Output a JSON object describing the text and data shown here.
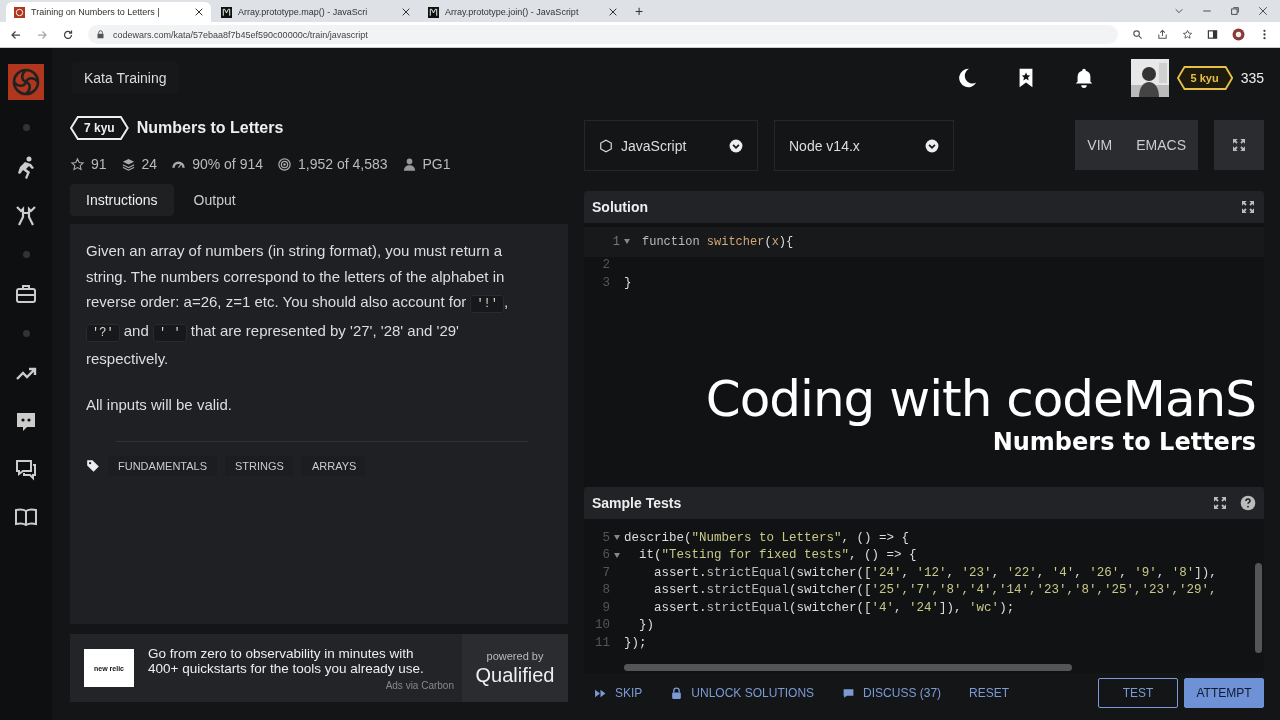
{
  "browser": {
    "tabs": [
      {
        "title": "Training on Numbers to Letters |",
        "selected": true
      },
      {
        "title": "Array.prototype.map() - JavaScri",
        "selected": false
      },
      {
        "title": "Array.prototype.join() - JavaScript",
        "selected": false
      }
    ],
    "new_tab": "+",
    "url": "codewars.com/kata/57ebaa8f7b45ef590c00000c/train/javascript"
  },
  "header": {
    "title": "Kata Training",
    "rank": "5 kyu",
    "honor": "335"
  },
  "kata": {
    "rank": "7 kyu",
    "title": "Numbers to Letters",
    "stats": [
      {
        "kind": "star",
        "text": "91"
      },
      {
        "kind": "collection",
        "text": "24"
      },
      {
        "kind": "satisfaction",
        "text": "90% of 914"
      },
      {
        "kind": "completed",
        "text": "1,952 of 4,583"
      },
      {
        "kind": "author",
        "text": "PG1"
      }
    ],
    "tabs": [
      {
        "label": "Instructions",
        "selected": true
      },
      {
        "label": "Output",
        "selected": false
      }
    ],
    "paragraphs": [
      [
        {
          "kind": "text",
          "text": "Given an array of numbers (in string format), you must return a string. The numbers correspond to the letters of the alphabet in reverse order: a=26, z=1 etc. You should also account for "
        },
        {
          "kind": "code",
          "text": "'!'"
        },
        {
          "kind": "text",
          "text": ", "
        },
        {
          "kind": "code",
          "text": "'?'"
        },
        {
          "kind": "text",
          "text": " and "
        },
        {
          "kind": "code",
          "text": "' '"
        },
        {
          "kind": "text",
          "text": " that are represented by '27', '28' and '29' respectively."
        }
      ],
      [
        {
          "kind": "text",
          "text": "All inputs will be valid."
        }
      ]
    ],
    "tags": [
      "FUNDAMENTALS",
      "STRINGS",
      "ARRAYS"
    ]
  },
  "ad": {
    "logo": "new relic",
    "text": "Go from zero to observability in minutes with 400+ quickstarts for the tools you already use.",
    "via": "Ads via Carbon",
    "powered_by": "powered by",
    "brand": "Qualified"
  },
  "editor": {
    "language": "JavaScript",
    "version": "Node v14.x",
    "modes": [
      "VIM",
      "EMACS"
    ],
    "solution": {
      "title": "Solution",
      "lines": [
        {
          "n": "1",
          "fold": true,
          "active": true,
          "seg": [
            {
              "kind": "kw",
              "text": "function "
            },
            {
              "kind": "fn",
              "text": "switcher"
            },
            {
              "kind": "plain",
              "text": "("
            },
            {
              "kind": "var",
              "text": "x"
            },
            {
              "kind": "plain",
              "text": "){"
            }
          ]
        },
        {
          "n": "2",
          "fold": false,
          "active": false
        },
        {
          "n": "3",
          "fold": false,
          "active": false,
          "seg": [
            {
              "kind": "plain",
              "text": "}"
            }
          ]
        }
      ]
    },
    "tests": {
      "title": "Sample Tests",
      "lines": [
        {
          "n": "5",
          "fold": true,
          "active": false,
          "seg": [
            {
              "kind": "plain",
              "text": "describe("
            },
            {
              "kind": "str",
              "text": "\"Numbers to Letters\""
            },
            {
              "kind": "plain",
              "text": ", () => {"
            }
          ]
        },
        {
          "n": "6",
          "fold": true,
          "active": false,
          "seg": [
            {
              "kind": "plain",
              "text": "  it("
            },
            {
              "kind": "str",
              "text": "\"Testing for fixed tests\""
            },
            {
              "kind": "plain",
              "text": ", () => {"
            }
          ]
        },
        {
          "n": "7",
          "fold": false,
          "active": false,
          "seg": [
            {
              "kind": "plain",
              "text": "    assert."
            },
            {
              "kind": "kw",
              "text": "strictEqual"
            },
            {
              "kind": "plain",
              "text": "(switcher(["
            },
            {
              "kind": "str",
              "text": "'24'"
            },
            {
              "kind": "plain",
              "text": ", "
            },
            {
              "kind": "str",
              "text": "'12'"
            },
            {
              "kind": "plain",
              "text": ", "
            },
            {
              "kind": "str",
              "text": "'23'"
            },
            {
              "kind": "plain",
              "text": ", "
            },
            {
              "kind": "str",
              "text": "'22'"
            },
            {
              "kind": "plain",
              "text": ", "
            },
            {
              "kind": "str",
              "text": "'4'"
            },
            {
              "kind": "plain",
              "text": ", "
            },
            {
              "kind": "str",
              "text": "'26'"
            },
            {
              "kind": "plain",
              "text": ", "
            },
            {
              "kind": "str",
              "text": "'9'"
            },
            {
              "kind": "plain",
              "text": ", "
            },
            {
              "kind": "str",
              "text": "'8'"
            },
            {
              "kind": "plain",
              "text": "]), "
            }
          ]
        },
        {
          "n": "8",
          "fold": false,
          "active": false,
          "seg": [
            {
              "kind": "plain",
              "text": "    assert."
            },
            {
              "kind": "kw",
              "text": "strictEqual"
            },
            {
              "kind": "plain",
              "text": "(switcher(["
            },
            {
              "kind": "str",
              "text": "'25','7','8','4','14','23','8','25','23','29',"
            }
          ]
        },
        {
          "n": "9",
          "fold": false,
          "active": false,
          "seg": [
            {
              "kind": "plain",
              "text": "    assert."
            },
            {
              "kind": "kw",
              "text": "strictEqual"
            },
            {
              "kind": "plain",
              "text": "(switcher(["
            },
            {
              "kind": "str",
              "text": "'4'"
            },
            {
              "kind": "plain",
              "text": ", "
            },
            {
              "kind": "str",
              "text": "'24'"
            },
            {
              "kind": "plain",
              "text": "]), "
            },
            {
              "kind": "str",
              "text": "'wc'"
            },
            {
              "kind": "plain",
              "text": ");"
            }
          ]
        },
        {
          "n": "10",
          "fold": false,
          "active": false,
          "seg": [
            {
              "kind": "plain",
              "text": "  })"
            }
          ]
        },
        {
          "n": "11",
          "fold": false,
          "active": false,
          "seg": [
            {
              "kind": "plain",
              "text": "});"
            }
          ]
        }
      ]
    }
  },
  "overlay": {
    "title": "Coding with codeManS",
    "subtitle": "Numbers to Letters"
  },
  "actions": [
    {
      "kind": "skip",
      "label": "SKIP"
    },
    {
      "kind": "unlock",
      "label": "UNLOCK SOLUTIONS"
    },
    {
      "kind": "discuss",
      "label": "DISCUSS (37)"
    },
    {
      "kind": "plain",
      "label": "RESET"
    }
  ],
  "buttons": [
    {
      "label": "TEST",
      "kind": "outline"
    },
    {
      "label": "ATTEMPT",
      "kind": "primary"
    }
  ]
}
